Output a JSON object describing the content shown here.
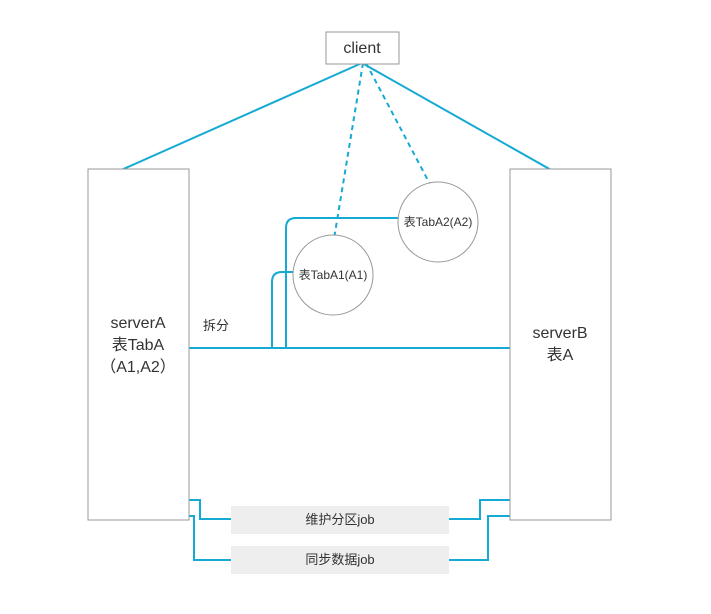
{
  "colors": {
    "line": "#14aad4",
    "node_stroke": "#999999",
    "job_fill": "#eeeeee"
  },
  "nodes": {
    "client": {
      "label": "client"
    },
    "serverA": {
      "line1": "serverA",
      "line2": "表TabA",
      "line3": "（A1,A2）"
    },
    "serverB": {
      "line1": "serverB",
      "line2": "表A"
    },
    "tabA1": {
      "label": "表TabA1(A1)"
    },
    "tabA2": {
      "label": "表TabA2(A2)"
    },
    "job1": {
      "label": "维护分区job"
    },
    "job2": {
      "label": "同步数据job"
    }
  },
  "edges": {
    "split": {
      "label": "拆分"
    }
  }
}
